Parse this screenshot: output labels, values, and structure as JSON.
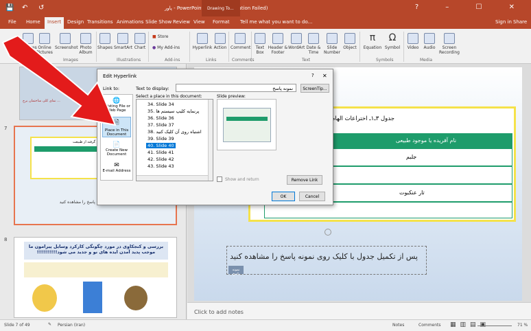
{
  "titlebar": {
    "title": "پاور - PowerPoint (Product Activation Failed)",
    "context_tab": "Drawing To...",
    "window_controls": [
      "?",
      "–",
      "☐",
      "✕"
    ]
  },
  "tabs": [
    "File",
    "Home",
    "Insert",
    "Design",
    "Transitions",
    "Animations",
    "Slide Show",
    "Review",
    "View",
    "Format"
  ],
  "tell_me": "Tell me what you want to do...",
  "signin": "Sign in",
  "share": "Share",
  "ribbon": {
    "items": [
      "Pictures",
      "Online Pictures",
      "Screenshot",
      "Photo Album",
      "Shapes",
      "SmartArt",
      "Chart",
      "Store",
      "My Add-ins",
      "Hyperlink",
      "Action",
      "Comment",
      "Text Box",
      "Header & Footer",
      "WordArt",
      "Date & Time",
      "Slide Number",
      "Object",
      "Equation",
      "Symbol",
      "Video",
      "Audio",
      "Screen Recording"
    ],
    "groups": [
      "Images",
      "Illustrations",
      "Add-ins",
      "Links",
      "Comments",
      "Text",
      "Symbols",
      "Media"
    ]
  },
  "slides": [
    {
      "number": "",
      "text": "نمای کلی ساختمان برج ..."
    },
    {
      "number": "7",
      "caption": "پس از تکمیل جدول با کلیک روی نمونه پاسخ را مشاهده کنید",
      "header": "اختراعات الهام گرفته از طبیعت"
    },
    {
      "number": "8",
      "title": "بررسی و کنجکاوی در مورد چگونگی کارکرد وسایل پیرامون ما موجب پدید آمدن ایده های نو و جدید می شود!!!!!!!!!!"
    }
  ],
  "main_slide": {
    "table_title": "جدول ۳ـ۱ـ اختراعات الهام گرفته از طبیعت",
    "col_header": "نام آفریده یا موجود طبیعی",
    "rows": [
      "جلبم",
      "",
      "تار عنکبوت",
      ""
    ],
    "caption": "پس از تکمیل جدول با کلیک روی نمونه پاسخ را مشاهده کنید",
    "answer_button": "نمونه پاسخ"
  },
  "notes_placeholder": "Click to add notes",
  "status": {
    "slide_info": "Slide 7 of 49",
    "language": "Persian (Iran)",
    "notes": "Notes",
    "comments": "Comments",
    "zoom": "71 %"
  },
  "dialog": {
    "title": "Edit Hyperlink",
    "help": "?",
    "close": "✕",
    "link_to": "Link to:",
    "text_to_display_label": "Text to display:",
    "text_to_display_value": "نمونه پاسخ",
    "screentip": "ScreenTip...",
    "select_place": "Select a place in this document:",
    "slide_preview": "Slide preview:",
    "nav": [
      "Existing File or Web Page",
      "Place in This Document",
      "Create New Document",
      "E-mail Address"
    ],
    "list": [
      "34. Slide 34",
      "35. پرنمایه کلیپ سیستم ها",
      "36. Slide 36",
      "37. Slide 37",
      "38. اشتباه روی آن کلیک کنید",
      "39. Slide 39",
      "40. Slide 40",
      "41. Slide 41",
      "42. Slide 42",
      "43. Slide 43"
    ],
    "selected_index": 6,
    "show_return": "Show and return",
    "remove_link": "Remove Link",
    "ok": "OK",
    "cancel": "Cancel"
  },
  "colors": {
    "accent": "#b7472a",
    "arrow": "#e31b1b",
    "frame": "#f5e24a",
    "table_header": "#1e9c6b"
  }
}
